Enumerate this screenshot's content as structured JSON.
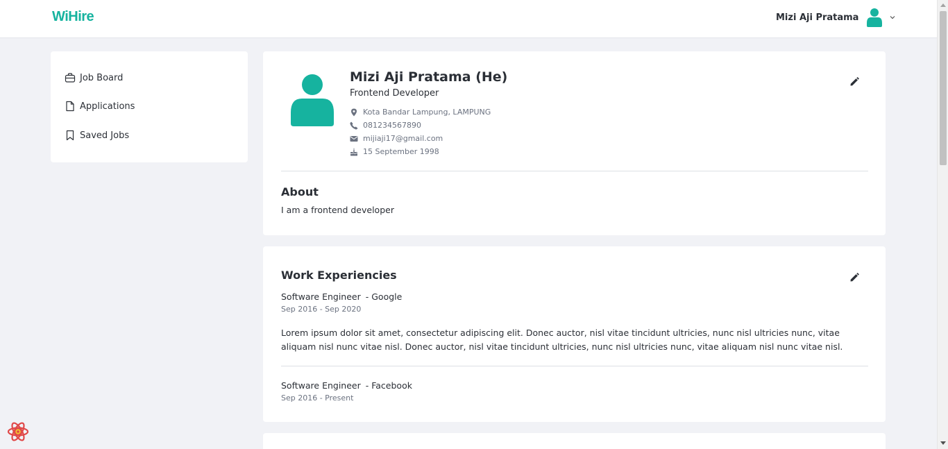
{
  "brand": {
    "logo_text": "WiHire",
    "accent": "#16b39f"
  },
  "header": {
    "user_name": "Mizi Aji Pratama"
  },
  "sidebar": {
    "items": [
      {
        "label": "Job Board",
        "icon": "briefcase-icon"
      },
      {
        "label": "Applications",
        "icon": "document-icon"
      },
      {
        "label": "Saved Jobs",
        "icon": "bookmark-icon"
      }
    ]
  },
  "profile": {
    "name": "Mizi Aji Pratama (He)",
    "title": "Frontend Developer",
    "location": "Kota Bandar Lampung, LAMPUNG",
    "phone": "081234567890",
    "email": "mijiaji17@gmail.com",
    "birthdate": "15 September 1998",
    "about_heading": "About",
    "about_text": "I am a frontend developer"
  },
  "work": {
    "heading": "Work Experiencies",
    "items": [
      {
        "role": "Software Engineer",
        "company": "- Google",
        "period": "Sep 2016 - Sep 2020",
        "description": "Lorem ipsum dolor sit amet, consectetur adipiscing elit. Donec auctor, nisl vitae tincidunt ultricies, nunc nisl ultricies nunc, vitae aliquam nisl nunc vitae nisl. Donec auctor, nisl vitae tincidunt ultricies, nunc nisl ultricies nunc, vitae aliquam nisl nunc vitae nisl."
      },
      {
        "role": "Software Engineer",
        "company": "- Facebook",
        "period": "Sep 2016 - Present"
      }
    ]
  }
}
